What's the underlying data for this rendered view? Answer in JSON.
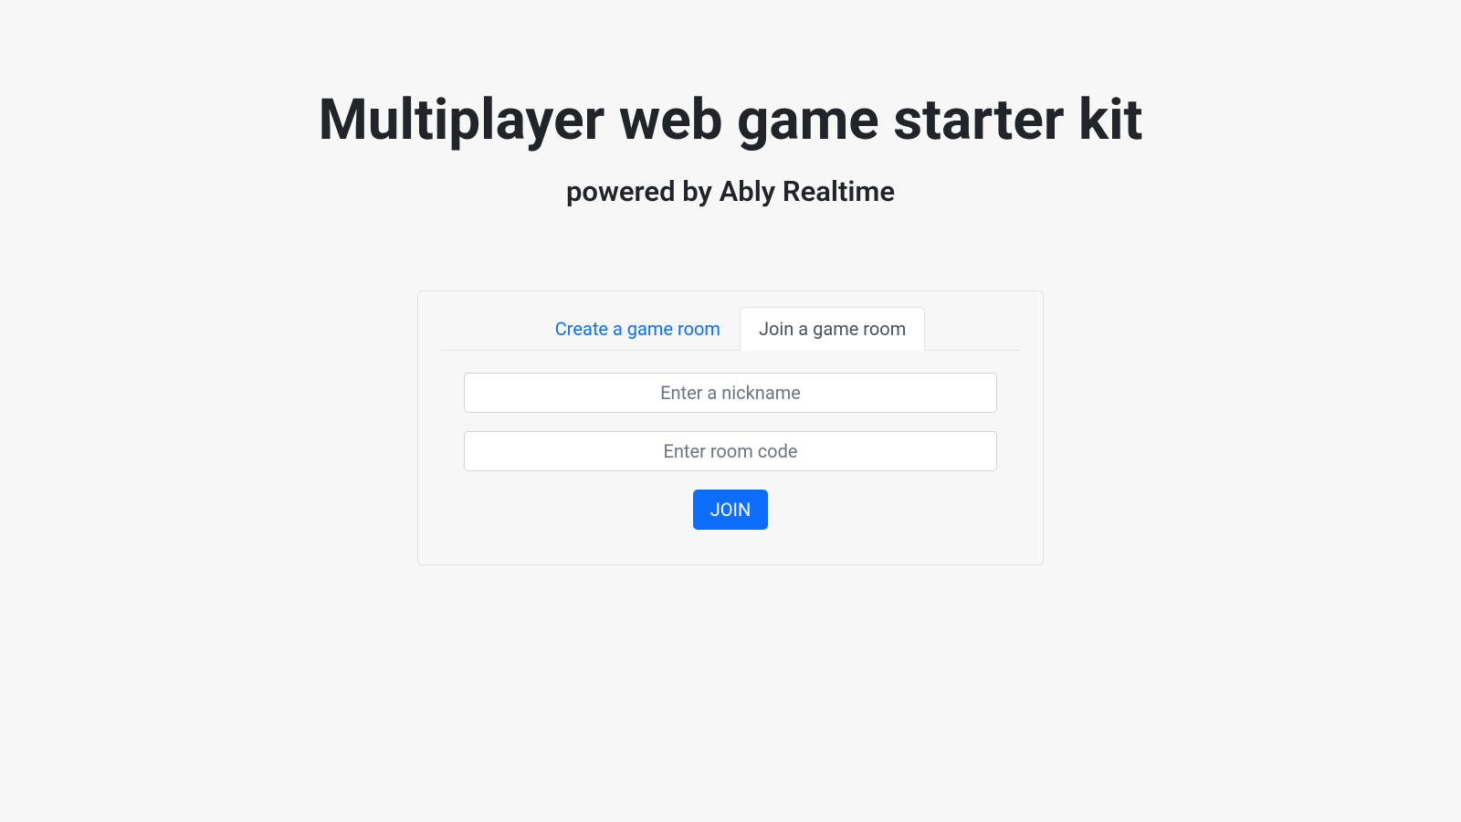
{
  "header": {
    "title": "Multiplayer web game starter kit",
    "subtitle": "powered by Ably Realtime"
  },
  "tabs": {
    "create": "Create a game room",
    "join": "Join a game room"
  },
  "form": {
    "nickname_placeholder": "Enter a nickname",
    "nickname_value": "",
    "roomcode_placeholder": "Enter room code",
    "roomcode_value": "",
    "join_button": "JOIN"
  },
  "colors": {
    "primary": "#0d6efd",
    "text_dark": "#212529",
    "text_muted": "#495057",
    "border": "#dee2e6",
    "background": "#f7f7f7"
  }
}
